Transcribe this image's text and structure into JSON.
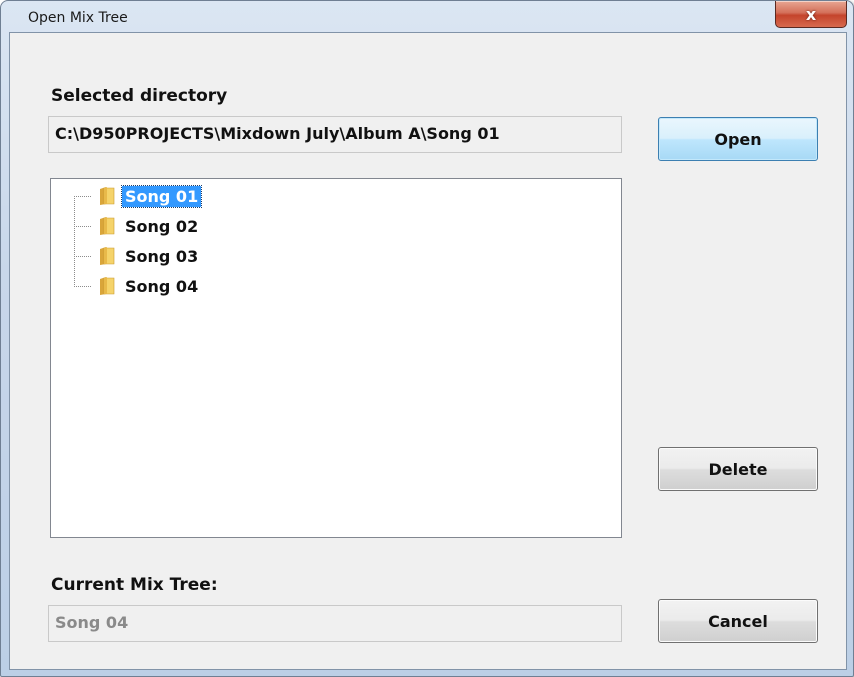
{
  "window": {
    "title": "Open Mix Tree",
    "close_label": "x"
  },
  "selected_directory": {
    "label": "Selected directory",
    "value": "C:\\D950PROJECTS\\Mixdown July\\Album A\\Song 01"
  },
  "tree": {
    "items": [
      {
        "label": "Song 01",
        "selected": true
      },
      {
        "label": "Song 02",
        "selected": false
      },
      {
        "label": "Song 03",
        "selected": false
      },
      {
        "label": "Song 04",
        "selected": false
      }
    ]
  },
  "current_mix_tree": {
    "label": "Current Mix Tree:",
    "value": "Song 04"
  },
  "buttons": {
    "open": "Open",
    "delete": "Delete",
    "cancel": "Cancel"
  },
  "icons": {
    "folder": "folder-icon",
    "close": "close-icon"
  }
}
